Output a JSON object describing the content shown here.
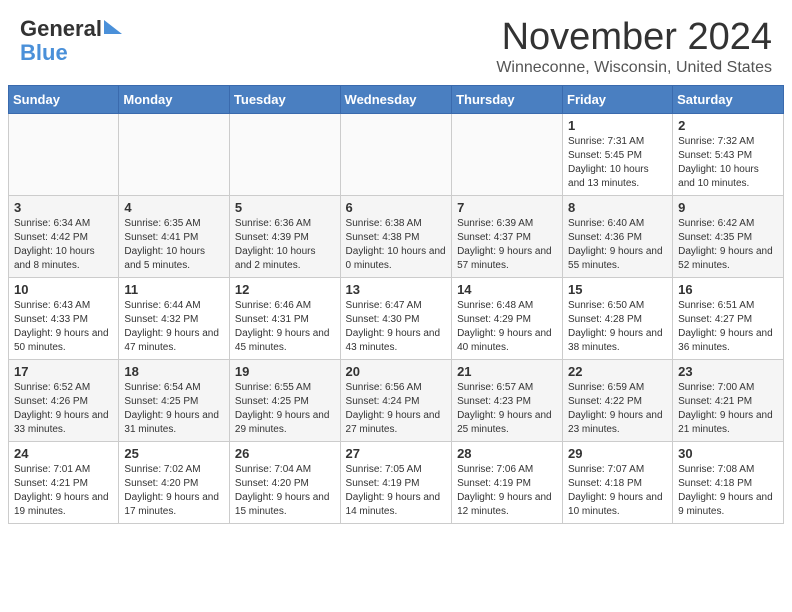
{
  "header": {
    "logo_line1": "General",
    "logo_line2": "Blue",
    "month": "November 2024",
    "location": "Winneconne, Wisconsin, United States"
  },
  "weekdays": [
    "Sunday",
    "Monday",
    "Tuesday",
    "Wednesday",
    "Thursday",
    "Friday",
    "Saturday"
  ],
  "weeks": [
    [
      {
        "day": "",
        "info": ""
      },
      {
        "day": "",
        "info": ""
      },
      {
        "day": "",
        "info": ""
      },
      {
        "day": "",
        "info": ""
      },
      {
        "day": "",
        "info": ""
      },
      {
        "day": "1",
        "info": "Sunrise: 7:31 AM\nSunset: 5:45 PM\nDaylight: 10 hours and 13 minutes."
      },
      {
        "day": "2",
        "info": "Sunrise: 7:32 AM\nSunset: 5:43 PM\nDaylight: 10 hours and 10 minutes."
      }
    ],
    [
      {
        "day": "3",
        "info": "Sunrise: 6:34 AM\nSunset: 4:42 PM\nDaylight: 10 hours and 8 minutes."
      },
      {
        "day": "4",
        "info": "Sunrise: 6:35 AM\nSunset: 4:41 PM\nDaylight: 10 hours and 5 minutes."
      },
      {
        "day": "5",
        "info": "Sunrise: 6:36 AM\nSunset: 4:39 PM\nDaylight: 10 hours and 2 minutes."
      },
      {
        "day": "6",
        "info": "Sunrise: 6:38 AM\nSunset: 4:38 PM\nDaylight: 10 hours and 0 minutes."
      },
      {
        "day": "7",
        "info": "Sunrise: 6:39 AM\nSunset: 4:37 PM\nDaylight: 9 hours and 57 minutes."
      },
      {
        "day": "8",
        "info": "Sunrise: 6:40 AM\nSunset: 4:36 PM\nDaylight: 9 hours and 55 minutes."
      },
      {
        "day": "9",
        "info": "Sunrise: 6:42 AM\nSunset: 4:35 PM\nDaylight: 9 hours and 52 minutes."
      }
    ],
    [
      {
        "day": "10",
        "info": "Sunrise: 6:43 AM\nSunset: 4:33 PM\nDaylight: 9 hours and 50 minutes."
      },
      {
        "day": "11",
        "info": "Sunrise: 6:44 AM\nSunset: 4:32 PM\nDaylight: 9 hours and 47 minutes."
      },
      {
        "day": "12",
        "info": "Sunrise: 6:46 AM\nSunset: 4:31 PM\nDaylight: 9 hours and 45 minutes."
      },
      {
        "day": "13",
        "info": "Sunrise: 6:47 AM\nSunset: 4:30 PM\nDaylight: 9 hours and 43 minutes."
      },
      {
        "day": "14",
        "info": "Sunrise: 6:48 AM\nSunset: 4:29 PM\nDaylight: 9 hours and 40 minutes."
      },
      {
        "day": "15",
        "info": "Sunrise: 6:50 AM\nSunset: 4:28 PM\nDaylight: 9 hours and 38 minutes."
      },
      {
        "day": "16",
        "info": "Sunrise: 6:51 AM\nSunset: 4:27 PM\nDaylight: 9 hours and 36 minutes."
      }
    ],
    [
      {
        "day": "17",
        "info": "Sunrise: 6:52 AM\nSunset: 4:26 PM\nDaylight: 9 hours and 33 minutes."
      },
      {
        "day": "18",
        "info": "Sunrise: 6:54 AM\nSunset: 4:25 PM\nDaylight: 9 hours and 31 minutes."
      },
      {
        "day": "19",
        "info": "Sunrise: 6:55 AM\nSunset: 4:25 PM\nDaylight: 9 hours and 29 minutes."
      },
      {
        "day": "20",
        "info": "Sunrise: 6:56 AM\nSunset: 4:24 PM\nDaylight: 9 hours and 27 minutes."
      },
      {
        "day": "21",
        "info": "Sunrise: 6:57 AM\nSunset: 4:23 PM\nDaylight: 9 hours and 25 minutes."
      },
      {
        "day": "22",
        "info": "Sunrise: 6:59 AM\nSunset: 4:22 PM\nDaylight: 9 hours and 23 minutes."
      },
      {
        "day": "23",
        "info": "Sunrise: 7:00 AM\nSunset: 4:21 PM\nDaylight: 9 hours and 21 minutes."
      }
    ],
    [
      {
        "day": "24",
        "info": "Sunrise: 7:01 AM\nSunset: 4:21 PM\nDaylight: 9 hours and 19 minutes."
      },
      {
        "day": "25",
        "info": "Sunrise: 7:02 AM\nSunset: 4:20 PM\nDaylight: 9 hours and 17 minutes."
      },
      {
        "day": "26",
        "info": "Sunrise: 7:04 AM\nSunset: 4:20 PM\nDaylight: 9 hours and 15 minutes."
      },
      {
        "day": "27",
        "info": "Sunrise: 7:05 AM\nSunset: 4:19 PM\nDaylight: 9 hours and 14 minutes."
      },
      {
        "day": "28",
        "info": "Sunrise: 7:06 AM\nSunset: 4:19 PM\nDaylight: 9 hours and 12 minutes."
      },
      {
        "day": "29",
        "info": "Sunrise: 7:07 AM\nSunset: 4:18 PM\nDaylight: 9 hours and 10 minutes."
      },
      {
        "day": "30",
        "info": "Sunrise: 7:08 AM\nSunset: 4:18 PM\nDaylight: 9 hours and 9 minutes."
      }
    ]
  ]
}
